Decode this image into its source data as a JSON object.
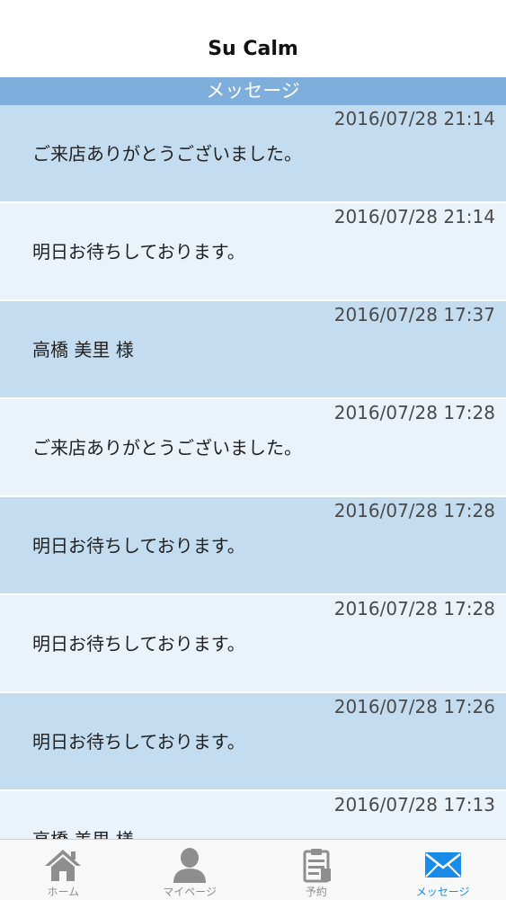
{
  "header": {
    "title": "Su Calm"
  },
  "section": {
    "title": "メッセージ"
  },
  "messages": [
    {
      "time": "2016/07/28 21:14",
      "text": "ご来店ありがとうございました。"
    },
    {
      "time": "2016/07/28 21:14",
      "text": "明日お待ちしております。"
    },
    {
      "time": "2016/07/28 17:37",
      "text": "高橋 美里 様"
    },
    {
      "time": "2016/07/28 17:28",
      "text": "ご来店ありがとうございました。"
    },
    {
      "time": "2016/07/28 17:28",
      "text": "明日お待ちしております。"
    },
    {
      "time": "2016/07/28 17:28",
      "text": "明日お待ちしております。"
    },
    {
      "time": "2016/07/28 17:26",
      "text": "明日お待ちしております。"
    },
    {
      "time": "2016/07/28 17:13",
      "text": "高橋 美里 様"
    }
  ],
  "tabs": [
    {
      "label": "ホーム",
      "icon": "home-icon"
    },
    {
      "label": "マイページ",
      "icon": "person-icon"
    },
    {
      "label": "予約",
      "icon": "clipboard-icon"
    },
    {
      "label": "メッセージ",
      "icon": "envelope-icon",
      "active": true
    }
  ],
  "colors": {
    "header_bar": "#7eaedc",
    "row_dark": "#c4dcef",
    "row_light": "#eaf2fa",
    "active_tab": "#1a8ce8",
    "inactive_tab": "#8e8e8e"
  }
}
